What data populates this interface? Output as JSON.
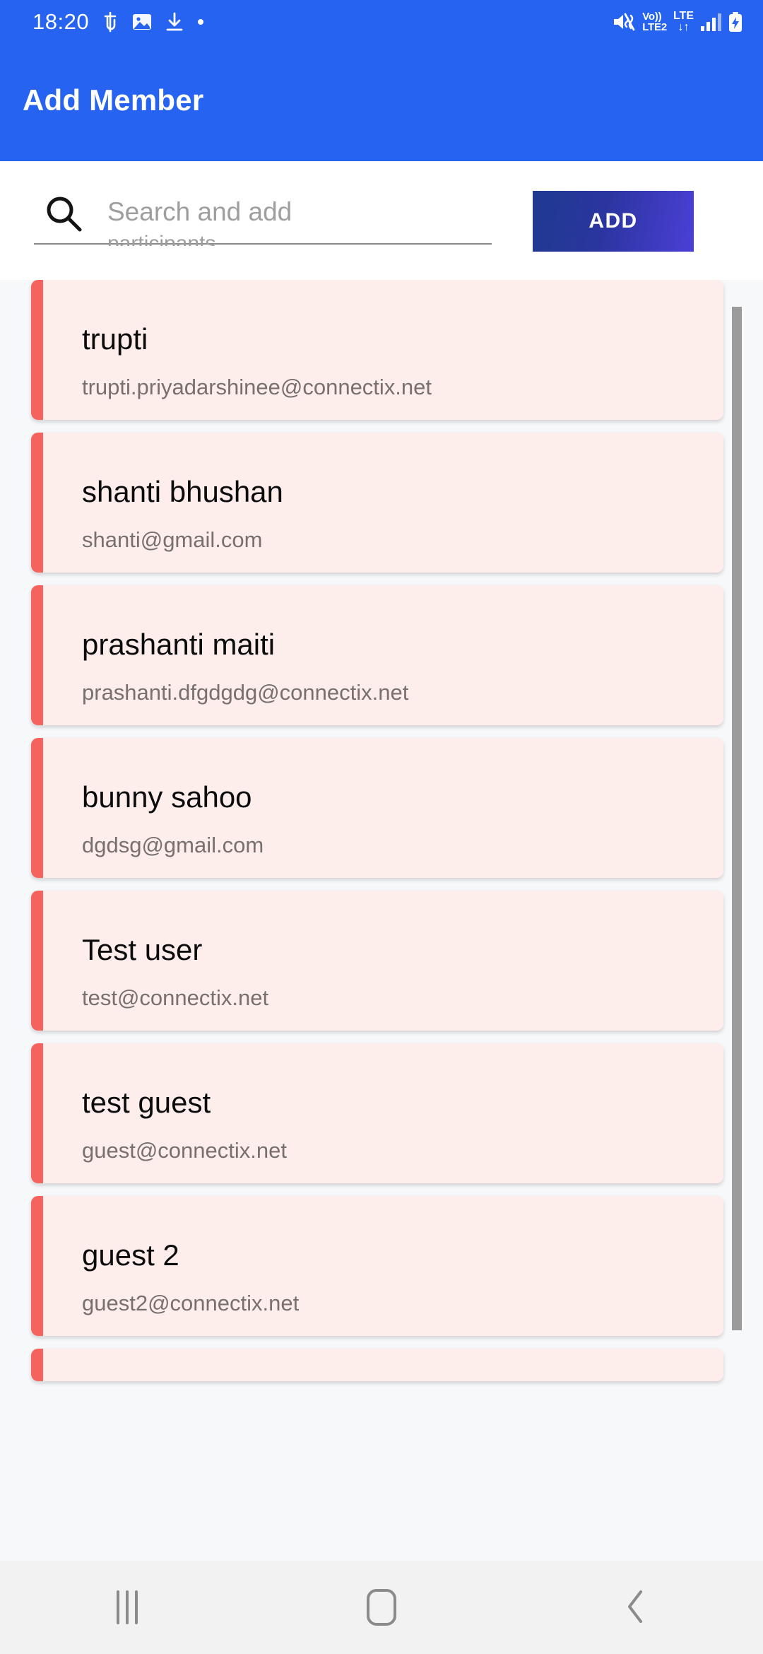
{
  "statusbar": {
    "clock": "18:20",
    "left_icons": [
      "phonepe-icon",
      "gallery-icon",
      "download-icon",
      "dot-icon"
    ],
    "right_icons": [
      "mute-icon",
      "volte-lte2-icon",
      "lte-data-icon",
      "signal-bars-icon",
      "battery-charging-icon"
    ],
    "volte_label": "Vo))",
    "lte2_label": "LTE2",
    "lte_label": "LTE",
    "data_arrows": "↓↑"
  },
  "header": {
    "title": "Add Member",
    "background_color": "#2563f0"
  },
  "search": {
    "placeholder": "Search and add",
    "value": "",
    "sub_hint": "participants",
    "icon": "search-icon",
    "add_label": "ADD",
    "add_gradient_from": "#1f3a8f",
    "add_gradient_to": "#4b3fd6"
  },
  "list": {
    "accent_color": "#f4635e",
    "card_color": "#fdeeec",
    "members": [
      {
        "name": "trupti",
        "email": "trupti.priyadarshinee@connectix.net"
      },
      {
        "name": "shanti bhushan",
        "email": "shanti@gmail.com"
      },
      {
        "name": "prashanti maiti",
        "email": "prashanti.dfgdgdg@connectix.net"
      },
      {
        "name": "bunny sahoo",
        "email": "dgdsg@gmail.com"
      },
      {
        "name": "Test user",
        "email": "test@connectix.net"
      },
      {
        "name": "test guest",
        "email": "guest@connectix.net"
      },
      {
        "name": "guest 2",
        "email": "guest2@connectix.net"
      }
    ]
  },
  "navbar": {
    "recents_label": "Recents",
    "home_label": "Home",
    "back_label": "Back"
  }
}
